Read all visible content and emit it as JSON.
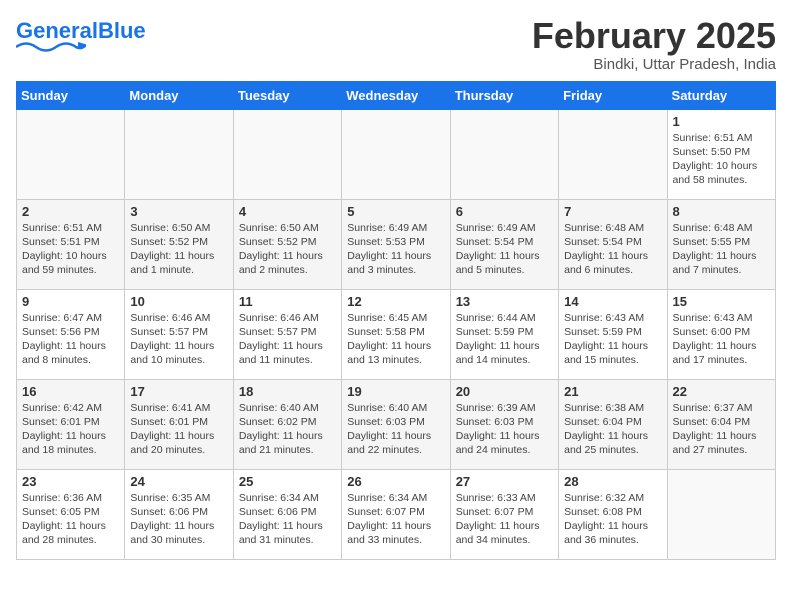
{
  "header": {
    "logo_general": "General",
    "logo_blue": "Blue",
    "month_title": "February 2025",
    "subtitle": "Bindki, Uttar Pradesh, India"
  },
  "weekdays": [
    "Sunday",
    "Monday",
    "Tuesday",
    "Wednesday",
    "Thursday",
    "Friday",
    "Saturday"
  ],
  "weeks": [
    [
      {
        "day": "",
        "detail": ""
      },
      {
        "day": "",
        "detail": ""
      },
      {
        "day": "",
        "detail": ""
      },
      {
        "day": "",
        "detail": ""
      },
      {
        "day": "",
        "detail": ""
      },
      {
        "day": "",
        "detail": ""
      },
      {
        "day": "1",
        "detail": "Sunrise: 6:51 AM\nSunset: 5:50 PM\nDaylight: 10 hours and 58 minutes."
      }
    ],
    [
      {
        "day": "2",
        "detail": "Sunrise: 6:51 AM\nSunset: 5:51 PM\nDaylight: 10 hours and 59 minutes."
      },
      {
        "day": "3",
        "detail": "Sunrise: 6:50 AM\nSunset: 5:52 PM\nDaylight: 11 hours and 1 minute."
      },
      {
        "day": "4",
        "detail": "Sunrise: 6:50 AM\nSunset: 5:52 PM\nDaylight: 11 hours and 2 minutes."
      },
      {
        "day": "5",
        "detail": "Sunrise: 6:49 AM\nSunset: 5:53 PM\nDaylight: 11 hours and 3 minutes."
      },
      {
        "day": "6",
        "detail": "Sunrise: 6:49 AM\nSunset: 5:54 PM\nDaylight: 11 hours and 5 minutes."
      },
      {
        "day": "7",
        "detail": "Sunrise: 6:48 AM\nSunset: 5:54 PM\nDaylight: 11 hours and 6 minutes."
      },
      {
        "day": "8",
        "detail": "Sunrise: 6:48 AM\nSunset: 5:55 PM\nDaylight: 11 hours and 7 minutes."
      }
    ],
    [
      {
        "day": "9",
        "detail": "Sunrise: 6:47 AM\nSunset: 5:56 PM\nDaylight: 11 hours and 8 minutes."
      },
      {
        "day": "10",
        "detail": "Sunrise: 6:46 AM\nSunset: 5:57 PM\nDaylight: 11 hours and 10 minutes."
      },
      {
        "day": "11",
        "detail": "Sunrise: 6:46 AM\nSunset: 5:57 PM\nDaylight: 11 hours and 11 minutes."
      },
      {
        "day": "12",
        "detail": "Sunrise: 6:45 AM\nSunset: 5:58 PM\nDaylight: 11 hours and 13 minutes."
      },
      {
        "day": "13",
        "detail": "Sunrise: 6:44 AM\nSunset: 5:59 PM\nDaylight: 11 hours and 14 minutes."
      },
      {
        "day": "14",
        "detail": "Sunrise: 6:43 AM\nSunset: 5:59 PM\nDaylight: 11 hours and 15 minutes."
      },
      {
        "day": "15",
        "detail": "Sunrise: 6:43 AM\nSunset: 6:00 PM\nDaylight: 11 hours and 17 minutes."
      }
    ],
    [
      {
        "day": "16",
        "detail": "Sunrise: 6:42 AM\nSunset: 6:01 PM\nDaylight: 11 hours and 18 minutes."
      },
      {
        "day": "17",
        "detail": "Sunrise: 6:41 AM\nSunset: 6:01 PM\nDaylight: 11 hours and 20 minutes."
      },
      {
        "day": "18",
        "detail": "Sunrise: 6:40 AM\nSunset: 6:02 PM\nDaylight: 11 hours and 21 minutes."
      },
      {
        "day": "19",
        "detail": "Sunrise: 6:40 AM\nSunset: 6:03 PM\nDaylight: 11 hours and 22 minutes."
      },
      {
        "day": "20",
        "detail": "Sunrise: 6:39 AM\nSunset: 6:03 PM\nDaylight: 11 hours and 24 minutes."
      },
      {
        "day": "21",
        "detail": "Sunrise: 6:38 AM\nSunset: 6:04 PM\nDaylight: 11 hours and 25 minutes."
      },
      {
        "day": "22",
        "detail": "Sunrise: 6:37 AM\nSunset: 6:04 PM\nDaylight: 11 hours and 27 minutes."
      }
    ],
    [
      {
        "day": "23",
        "detail": "Sunrise: 6:36 AM\nSunset: 6:05 PM\nDaylight: 11 hours and 28 minutes."
      },
      {
        "day": "24",
        "detail": "Sunrise: 6:35 AM\nSunset: 6:06 PM\nDaylight: 11 hours and 30 minutes."
      },
      {
        "day": "25",
        "detail": "Sunrise: 6:34 AM\nSunset: 6:06 PM\nDaylight: 11 hours and 31 minutes."
      },
      {
        "day": "26",
        "detail": "Sunrise: 6:34 AM\nSunset: 6:07 PM\nDaylight: 11 hours and 33 minutes."
      },
      {
        "day": "27",
        "detail": "Sunrise: 6:33 AM\nSunset: 6:07 PM\nDaylight: 11 hours and 34 minutes."
      },
      {
        "day": "28",
        "detail": "Sunrise: 6:32 AM\nSunset: 6:08 PM\nDaylight: 11 hours and 36 minutes."
      },
      {
        "day": "",
        "detail": ""
      }
    ]
  ]
}
